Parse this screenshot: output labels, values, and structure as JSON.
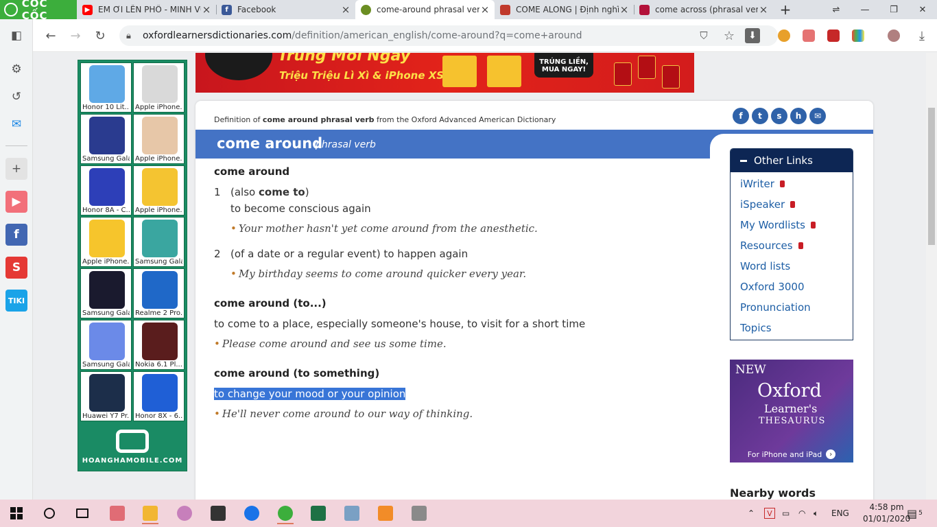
{
  "browser": {
    "brand": "CỐC CỐC",
    "tabs": [
      {
        "title": "EM ƠI LÊN PHỐ - MINH VU",
        "favicon": "youtube-icon",
        "color": "#ff0000"
      },
      {
        "title": "Facebook",
        "favicon": "facebook-icon",
        "color": "#3b5998"
      },
      {
        "title": "come-around phrasal verb",
        "favicon": "oxford-icon",
        "color": "#6b8e23",
        "active": true
      },
      {
        "title": "COME ALONG | Định nghĩa",
        "favicon": "cambridge-icon",
        "color": "#c0392b"
      },
      {
        "title": "come across (phrasal verb)",
        "favicon": "dictionary-icon",
        "color": "#b3123a"
      }
    ],
    "url_host": "oxfordlearnersdictionaries.com",
    "url_path": "/definition/american_english/come-around?q=come+around"
  },
  "ad": {
    "phones": [
      {
        "caption": "Honor 10 Lit...",
        "color": "#5fa9e6"
      },
      {
        "caption": "Apple iPhone...",
        "color": "#d9d9d9"
      },
      {
        "caption": "Samsung Gala...",
        "color": "#2a3b8f"
      },
      {
        "caption": "Apple iPhone...",
        "color": "#e7c7a8"
      },
      {
        "caption": "Honor 8A - C...",
        "color": "#2d3fb8"
      },
      {
        "caption": "Apple iPhone...",
        "color": "#f4c431"
      },
      {
        "caption": "Apple iPhone...",
        "color": "#f6c52c"
      },
      {
        "caption": "Samsung Gala...",
        "color": "#3aa6a0"
      },
      {
        "caption": "Samsung Gala...",
        "color": "#1a1a2e"
      },
      {
        "caption": "Realme 2 Pro...",
        "color": "#1f68c8"
      },
      {
        "caption": "Samsung Gala...",
        "color": "#6b8ae8"
      },
      {
        "caption": "Nokia 6.1 Pl...",
        "color": "#5a1d1d"
      },
      {
        "caption": "Huawei Y7 Pr...",
        "color": "#1c2e4a"
      },
      {
        "caption": "Honor 8X - 6...",
        "color": "#1f5fd6"
      }
    ],
    "brand": "HOANGHAMOBILE.COM"
  },
  "banner": {
    "headline": "Trúng Mỗi Ngày",
    "subline": "Triệu Triệu Lì Xì & iPhone XS",
    "cta_line1": "TRÚNG LIỀN,",
    "cta_line2": "MUA NGAY!"
  },
  "dictionary": {
    "source_prefix": "Definition of",
    "source_bold": "come around phrasal verb",
    "source_suffix": "from the Oxford Advanced American Dictionary",
    "headword": "come around",
    "part_of_speech": "phrasal verb",
    "entries": [
      {
        "phrase": "come around",
        "senses": [
          {
            "num": "1",
            "pre": "(also",
            "also": "come to",
            "post": ")",
            "def": "to become conscious again",
            "example": "Your mother hasn't yet come around from the anesthetic."
          },
          {
            "num": "2",
            "def": "(of a date or a regular event) to happen again",
            "example": "My birthday seems to come around quicker every year."
          }
        ]
      },
      {
        "phrase": "come around (to...)",
        "def": "to come to a place, especially someone's house, to visit for a short time",
        "example": "Please come around and see us some time."
      },
      {
        "phrase": "come around (to something)",
        "def": "to change your mood or your opinion",
        "example": "He'll never come around to our way of thinking."
      }
    ],
    "other_links": {
      "title": "Other Links",
      "items": [
        {
          "label": "iWriter",
          "locked": true
        },
        {
          "label": "iSpeaker",
          "locked": true
        },
        {
          "label": "My Wordlists",
          "locked": true
        },
        {
          "label": "Resources",
          "locked": true
        },
        {
          "label": "Word lists",
          "locked": false
        },
        {
          "label": "Oxford 3000",
          "locked": false
        },
        {
          "label": "Pronunciation",
          "locked": false
        },
        {
          "label": "Topics",
          "locked": false
        }
      ]
    },
    "thesaurus_ad": {
      "new": "NEW",
      "oxford": "Oxford",
      "learners": "Learner's",
      "thesaurus": "THESAURUS",
      "platforms": "For iPhone and iPad"
    },
    "nearby_words": "Nearby words"
  },
  "taskbar": {
    "language": "ENG",
    "time": "4:58 pm",
    "date": "01/01/2020",
    "notifications": "5"
  },
  "colors": {
    "headbar": "#4473c5",
    "link": "#1d5ea5",
    "other_links_header": "#0d2654",
    "selection": "#3875d7",
    "ad_green": "#1a8b64",
    "taskbar": "#f2d4dc"
  }
}
